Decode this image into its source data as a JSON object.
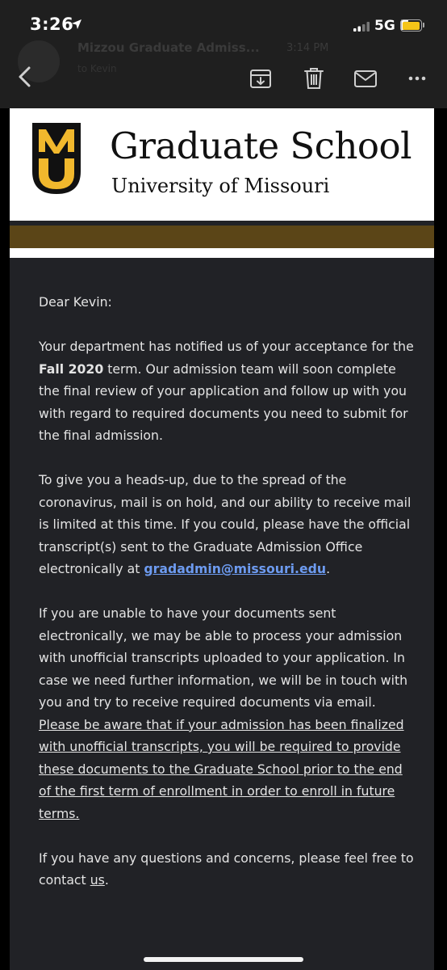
{
  "status": {
    "time": "3:26",
    "network": "5G E"
  },
  "toolbar": {
    "ghost_from": "Mizzou Graduate Admiss...",
    "ghost_time": "3:14 PM",
    "ghost_to": "to Kevin"
  },
  "header": {
    "logo_letters": "MU",
    "school_name": "Graduate School",
    "university": "University of Missouri",
    "brand_gold": "#f1b82d",
    "band_gold": "#5b4517"
  },
  "message": {
    "greeting": "Dear Kevin:",
    "p1_a": "Your department has notified us of your acceptance for the ",
    "p1_term": "Fall 2020",
    "p1_b": " term. Our admission team will soon complete the final review of your application and follow up with you with regard to required documents you need to submit for the final admission.",
    "p2_a": "To give you a heads-up, due to the spread of the coronavirus, mail is on hold, and our ability to receive mail is limited at this time. If you could, please have the official transcript(s) sent to the Graduate Admission Office electronically at ",
    "p2_email": "gradadmin@missouri.edu",
    "p2_b": ".",
    "p3_a": "If you are unable to have your documents sent electronically, we may be able to process your admission with unofficial transcripts uploaded to your application. In case we need further information, we will be in touch with you and try to receive required documents via email. ",
    "p3_underline": "Please be aware that if your admission has been finalized with unofficial transcripts, you will be required to provide these documents to the Graduate School prior to the end of the first term of enrollment in order to enroll in future terms.",
    "p4_a": "If you have any questions and concerns, please feel free to contact ",
    "p4_link": "us",
    "p4_b": "."
  }
}
